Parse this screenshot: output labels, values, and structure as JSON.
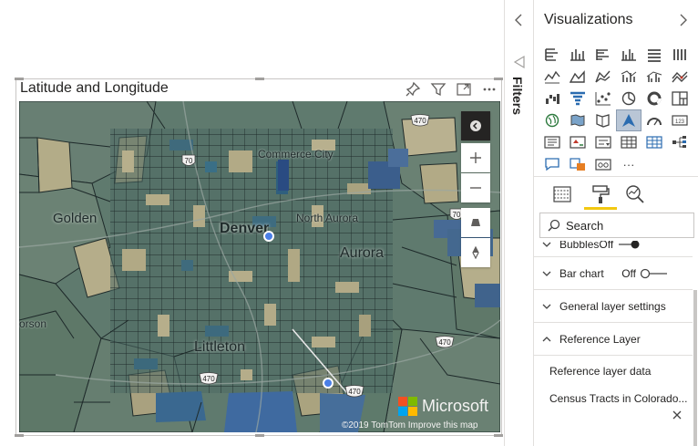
{
  "visual": {
    "title": "Latitude and Longitude"
  },
  "map": {
    "labels": {
      "commerce_city": "Commerce City",
      "golden": "Golden",
      "denver": "Denver",
      "north_aurora": "North Aurora",
      "aurora": "Aurora",
      "littleton": "Littleton",
      "arvada_cut": "orson"
    },
    "highway_shields": [
      "470",
      "70",
      "470",
      "470",
      "470",
      "70"
    ],
    "logo": "Microsoft",
    "attribution": "©2019 TomTom  Improve this map",
    "colors": {
      "land": "#5f7a6e",
      "tract_dark": "#3f6a7c",
      "tract_light": "#b5ad8a",
      "point": "#4a7fe6"
    }
  },
  "filters": {
    "label": "Filters"
  },
  "viz_pane": {
    "title": "Visualizations",
    "more": "···",
    "search_placeholder": "Search",
    "format_items": {
      "bubbles": "Bubbles",
      "bubbles_state": "Off",
      "bar_chart": "Bar chart",
      "bar_chart_state": "Off",
      "general_layer": "General layer settings",
      "reference_layer": "Reference Layer",
      "reference_layer_data": "Reference layer data",
      "census_tracts": "Census Tracts in Colorado..."
    }
  }
}
